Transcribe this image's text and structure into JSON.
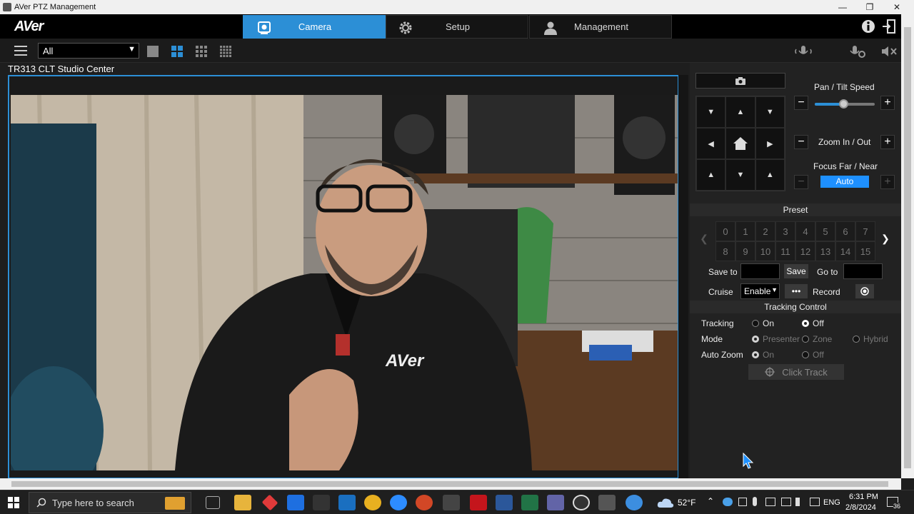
{
  "window": {
    "title": "AVer PTZ Management"
  },
  "header": {
    "logo": "AVer",
    "tabs": [
      {
        "label": "Camera",
        "active": true
      },
      {
        "label": "Setup",
        "active": false
      },
      {
        "label": "Management",
        "active": false
      }
    ]
  },
  "toolbar": {
    "group_select": "All"
  },
  "camera": {
    "name": "TR313 CLT Studio Center",
    "shirt_logo": "AVer"
  },
  "controls": {
    "pan_tilt_label": "Pan / Tilt Speed",
    "pan_tilt_speed_fraction": 0.48,
    "zoom_label": "Zoom In / Out",
    "focus_label": "Focus Far / Near",
    "focus_mode": "Auto"
  },
  "preset": {
    "title": "Preset",
    "numbers": [
      "0",
      "1",
      "2",
      "3",
      "4",
      "5",
      "6",
      "7",
      "8",
      "9",
      "10",
      "11",
      "12",
      "13",
      "14",
      "15"
    ],
    "save_to_label": "Save to",
    "save_button": "Save",
    "goto_label": "Go to",
    "cruise_label": "Cruise",
    "cruise_value": "Enable",
    "more_button": "•••",
    "record_label": "Record"
  },
  "tracking": {
    "title": "Tracking Control",
    "tracking_label": "Tracking",
    "mode_label": "Mode",
    "auto_zoom_label": "Auto Zoom",
    "on": "On",
    "off": "Off",
    "presenter": "Presenter",
    "zone": "Zone",
    "hybrid": "Hybrid",
    "click_track": "Click Track"
  },
  "taskbar": {
    "search_placeholder": "Type here to search",
    "weather": "52°F",
    "language": "ENG",
    "time": "6:31 PM",
    "date": "2/8/2024",
    "notifications": "36"
  },
  "colors": {
    "accent": "#2c8fd6",
    "focus_auto": "#1e90ff"
  }
}
